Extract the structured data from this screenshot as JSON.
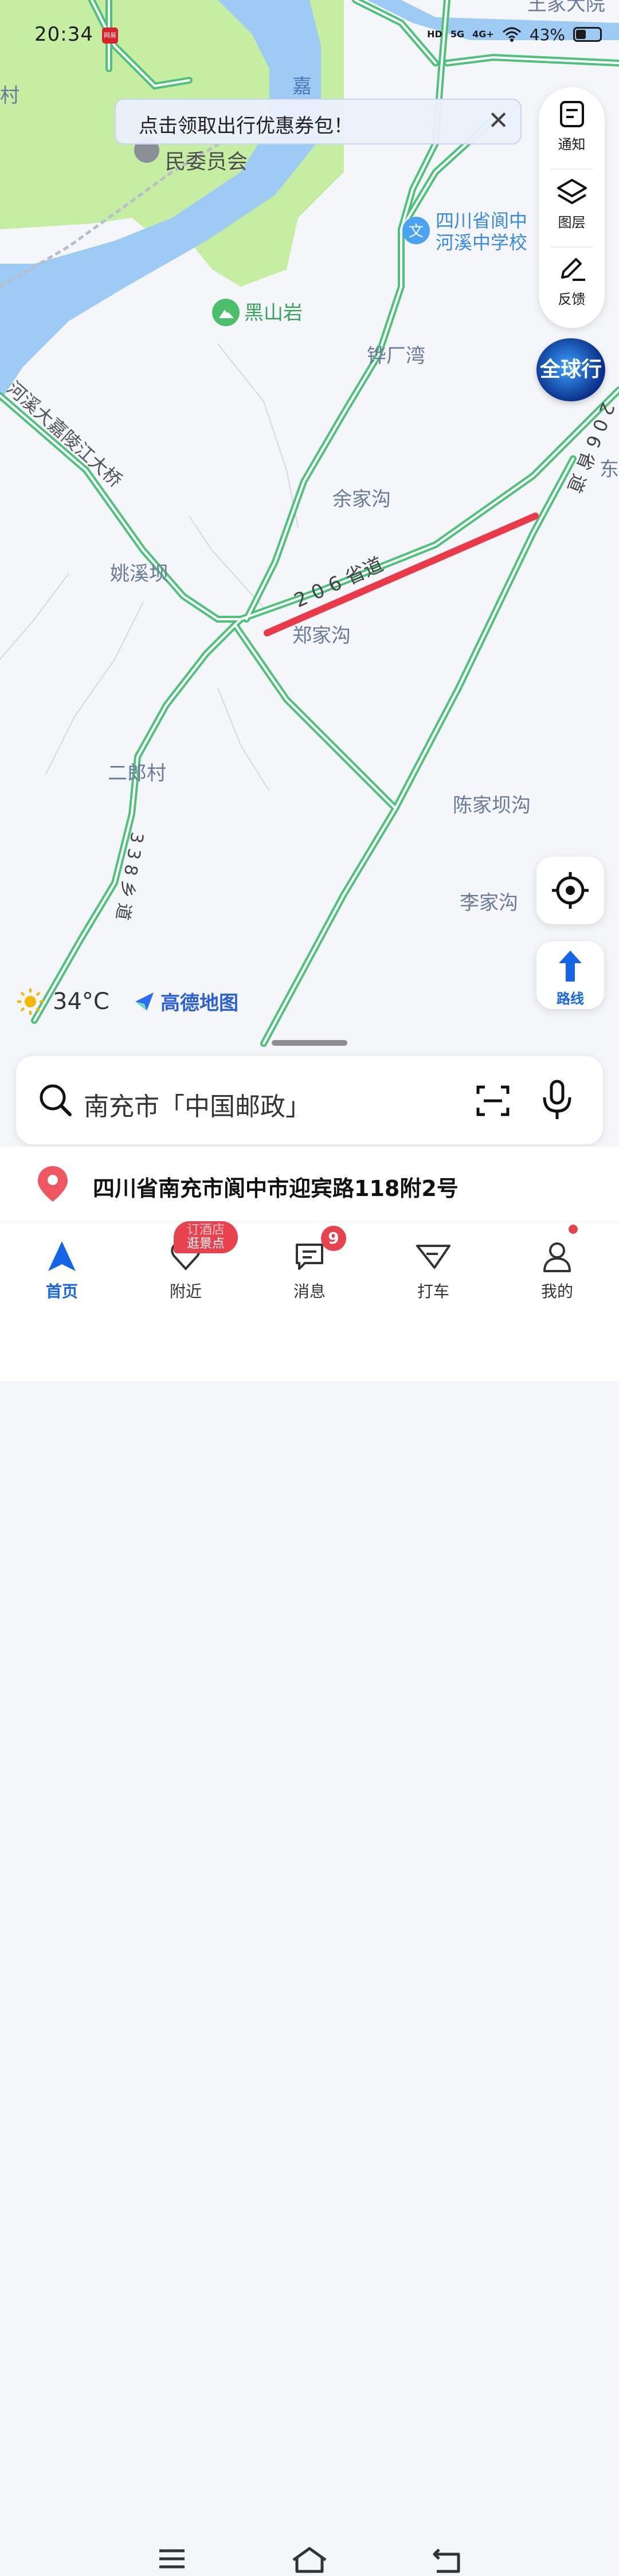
{
  "status_bar": {
    "time": "20:34",
    "app_badge": "网易",
    "hd": "HD",
    "net1": "5G",
    "net2": "4G+",
    "battery": "43%",
    "battery_level": 0.43
  },
  "promo": {
    "text": "点击领取出行优惠券包！"
  },
  "toolbar": {
    "notify_label": "通知",
    "layer_label": "图层",
    "feedback_label": "反馈",
    "globe_label": "全球行",
    "route_label": "路线"
  },
  "map": {
    "labels": {
      "top_right_partial": "王家大院",
      "cun": "村",
      "jia": "嘉",
      "committee": "民委员会",
      "school_line1": "四川省阆中",
      "school_line2": "河溪中学校",
      "heishan": "黑山岩",
      "chanwan": "铧厂湾",
      "yujiagou": "余家沟",
      "yaoxiba": "姚溪坝",
      "zhengjiagou": "郑家沟",
      "erlang": "二郎村",
      "chenjia": "陈家坝沟",
      "lijia": "李家沟",
      "dong": "东",
      "bridge": "河溪大嘉陵江大桥",
      "road206": "2 0 6 省道",
      "road206_right": "2 0 6 省 道",
      "road338": "3 3 8 乡 道"
    }
  },
  "weather": {
    "temp": "34°C"
  },
  "brand": {
    "name": "高德地图"
  },
  "search": {
    "text": "南充市「中国邮政」"
  },
  "address": {
    "text": "四川省南充市阆中市迎宾路118附2号"
  },
  "nav": {
    "home": "首页",
    "nearby": "附近",
    "messages": "消息",
    "taxi": "打车",
    "mine": "我的",
    "nearby_bubble_line1": "订酒店",
    "nearby_bubble_line2": "逛景点",
    "messages_badge": "9"
  },
  "colors": {
    "accent": "#1565e8",
    "water": "#9ecbf3",
    "green_area": "#c5eea2",
    "road": "#4cc27a",
    "route_line": "#ea3a4a",
    "badge": "#e9424f"
  }
}
